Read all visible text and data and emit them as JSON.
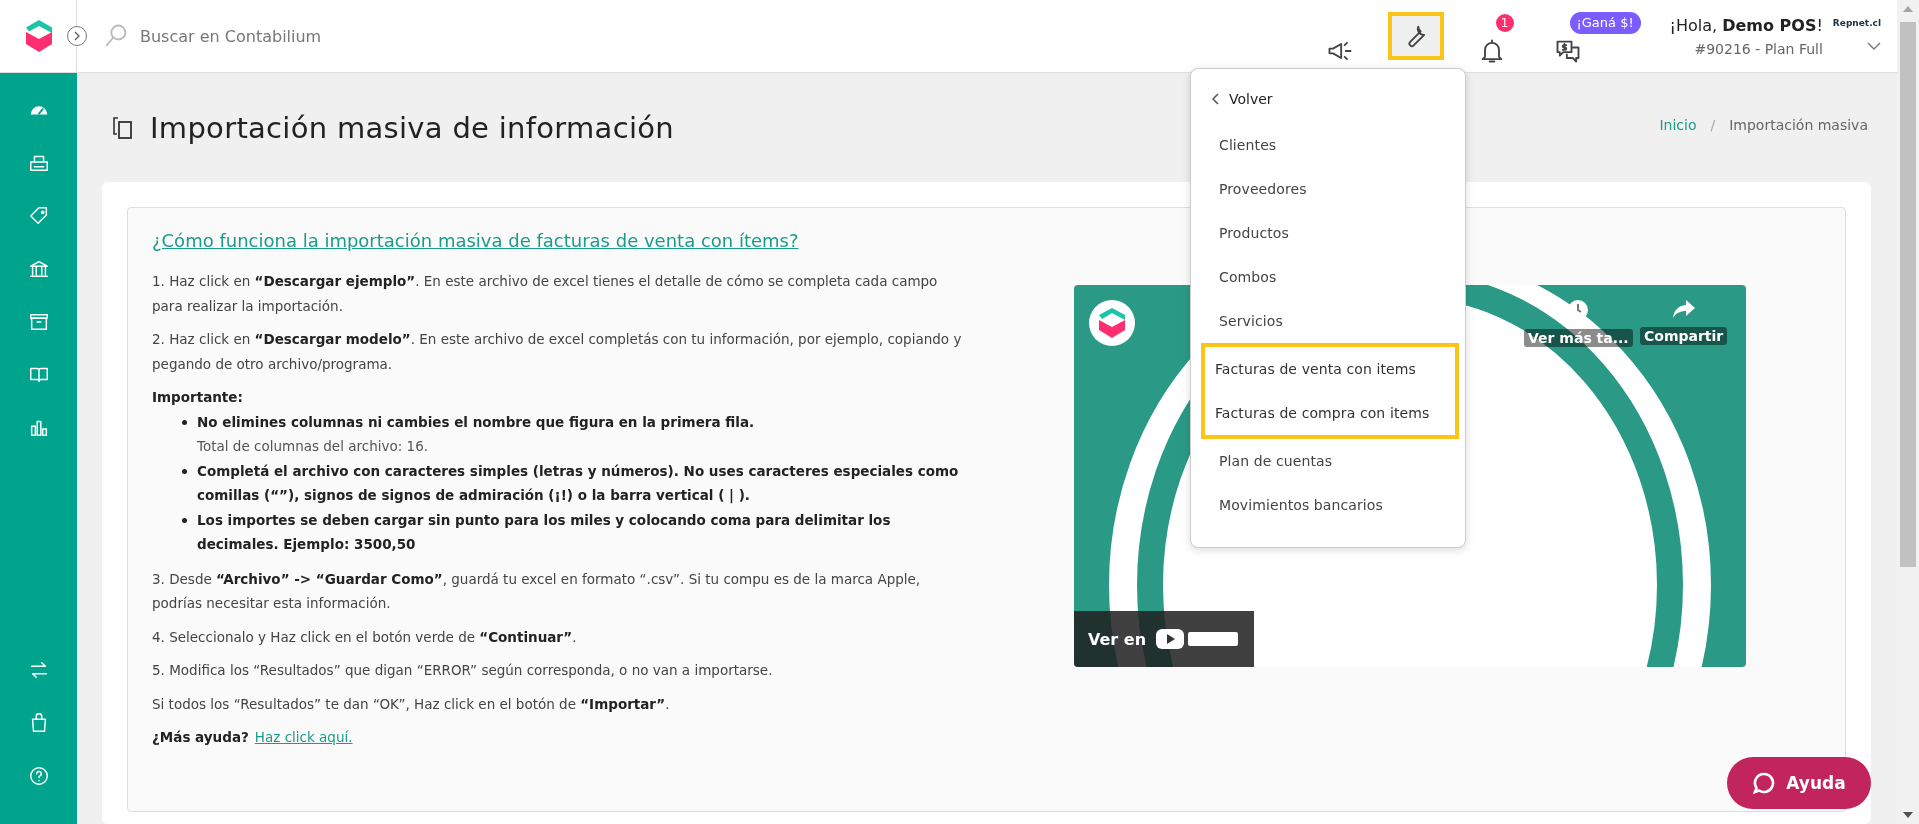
{
  "topbar": {
    "search": {
      "placeholder": "Buscar en Contabilium"
    },
    "actions": [
      {
        "kind": "megaphone",
        "highlighted": false
      },
      {
        "kind": "wrench",
        "highlighted": true
      },
      {
        "kind": "bell",
        "highlighted": false,
        "badge": "1"
      },
      {
        "kind": "chat",
        "highlighted": false,
        "badge": "¡Ganá $!"
      }
    ],
    "user": {
      "greeting": "¡Hola, **Demo POS**!",
      "account": "#90216 - Plan Full",
      "brand": "Repnet.cl"
    }
  },
  "sidebar": {
    "items": [
      {
        "kind": "gauge"
      },
      {
        "kind": "printer"
      },
      {
        "kind": "tag"
      },
      {
        "kind": "bank"
      },
      {
        "kind": "box"
      },
      {
        "kind": "book"
      },
      {
        "kind": "chart"
      }
    ],
    "bottom_items": [
      {
        "kind": "swap"
      },
      {
        "kind": "bag"
      },
      {
        "kind": "help"
      }
    ]
  },
  "page": {
    "title": "Importación masiva de información",
    "breadcrumb": [
      "Inicio",
      "Importación masiva"
    ],
    "breadcrumb_separator": "/"
  },
  "content": {
    "heading_link": "¿Cómo funciona la importación masiva de facturas de venta con ítems?",
    "blocks": [
      {
        "kind": "text",
        "text": "1. Haz click en **“Descargar ejemplo”**. En este archivo de excel tienes el detalle de cómo se completa cada campo para realizar la importación."
      },
      {
        "kind": "text",
        "text": "2. Haz click en **“Descargar modelo”**. En este archivo de excel completás con tu información, por ejemplo, copiando y pegando de otro archivo/programa."
      },
      {
        "kind": "label",
        "text": "Importante:"
      },
      {
        "kind": "bullets",
        "items": [
          {
            "text": "No elimines columnas ni cambies el nombre que figura en la primera fila.",
            "note": "Total de columnas del archivo: 16."
          },
          {
            "text": "Completá el archivo con caracteres simples (letras y números). No uses caracteres especiales como comillas (“”), signos de signos de admiración (¡!) o la barra vertical ( | )."
          },
          {
            "text": "Los importes se deben cargar sin punto para los miles y colocando coma para delimitar los decimales. Ejemplo: 3500,50"
          }
        ]
      },
      {
        "kind": "text",
        "text": "3. Desde **“Archivo” -> “Guardar Como”**, guardá tu excel en formato “.csv”. Si tu compu es de la marca Apple, podrías necesitar esta información."
      },
      {
        "kind": "text",
        "text": "4. Seleccionalo y Haz click en el botón verde de **“Continuar”**."
      },
      {
        "kind": "text",
        "text": "5. Modifica los “Resultados” que digan “ERROR” según corresponda, o no van a importarse."
      },
      {
        "kind": "text",
        "text": "Si todos los “Resultados” te dan “OK”, Haz click en el botón de **“Importar”**."
      }
    ],
    "help": {
      "label": "¿Más ayuda?",
      "link": "Haz click aquí."
    },
    "video": {
      "more": "Ver más ta...",
      "share": "Compartir",
      "watch_on": "Ver en"
    }
  },
  "menu": {
    "back": "Volver",
    "items": [
      {
        "label": "Clientes",
        "highlighted": false
      },
      {
        "label": "Proveedores",
        "highlighted": false
      },
      {
        "label": "Productos",
        "highlighted": false
      },
      {
        "label": "Combos",
        "highlighted": false
      },
      {
        "label": "Servicios",
        "highlighted": false
      },
      {
        "label": "Facturas de venta con items",
        "highlighted": true
      },
      {
        "label": "Facturas de compra con items",
        "highlighted": true
      },
      {
        "label": "Plan de cuentas",
        "highlighted": false
      },
      {
        "label": "Movimientos bancarios",
        "highlighted": false
      }
    ]
  },
  "help_button": {
    "label": "Ayuda"
  }
}
